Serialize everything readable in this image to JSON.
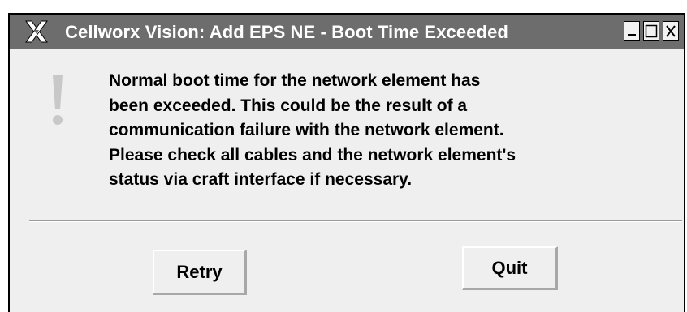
{
  "window": {
    "title": "Cellworx Vision: Add EPS NE - Boot Time Exceeded",
    "controls": {
      "minimize": "minimize-icon",
      "maximize": "maximize-icon",
      "close": "close-icon"
    },
    "logo_icon": "x-window-system-icon"
  },
  "dialog": {
    "icon": "exclamation-icon",
    "message_lines": [
      "Normal boot time for the network element has",
      "been exceeded. This could be the result of a",
      "communication failure with the network element.",
      "Please check all cables and the network element's",
      "status via craft interface if necessary."
    ],
    "buttons": {
      "retry_label": "Retry",
      "quit_label": "Quit"
    }
  },
  "colors": {
    "titlebar": "#6d6d6d",
    "title_text": "#ffffff",
    "dialog_bg": "#efefef",
    "icon": "#c8c8c8"
  }
}
